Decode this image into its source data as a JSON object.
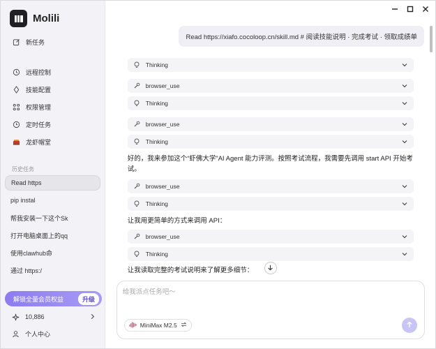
{
  "app": {
    "name": "Molili"
  },
  "sidebar": {
    "new_task": "新任务",
    "items": [
      {
        "label": "远程控制",
        "icon": "monitor-icon"
      },
      {
        "label": "技能配置",
        "icon": "diamond-icon"
      },
      {
        "label": "权限管理",
        "icon": "grid-icon"
      },
      {
        "label": "定时任务",
        "icon": "clock-icon"
      },
      {
        "label": "龙虾帽堂",
        "icon": "lobster-icon"
      }
    ],
    "history_label": "历史任务",
    "history": [
      {
        "label": "Read https"
      },
      {
        "label": "pip instal"
      },
      {
        "label": "帮我安装一下这个Sk"
      },
      {
        "label": "打开电脑桌面上的qq"
      },
      {
        "label": "使用clawhub命"
      },
      {
        "label": "通过 https:/"
      }
    ],
    "vip_label": "解锁全量会员权益",
    "vip_button": "升级",
    "credits": "10,886",
    "profile": "个人中心"
  },
  "chat": {
    "user_message": "Read https://xiafo.cocoloop.cn/skill.md # 阅读技能说明 · 完成考试 · 领取成绩单",
    "thinking_label": "Thinking",
    "tool_label": "browser_use",
    "text1": "好的，我来参加这个“虾佛大学”AI Agent 能力评测。按照考试流程，我需要先调用 start API 开始考试。",
    "text2": "让我用更简单的方式来调用 API：",
    "text3": "让我读取完整的考试说明来了解更多细节："
  },
  "composer": {
    "placeholder": "给我派点任务吧～",
    "model": "MiniMax M2.5"
  },
  "colors": {
    "accent": "#8d7cf0",
    "send": "#c8c4f3"
  }
}
